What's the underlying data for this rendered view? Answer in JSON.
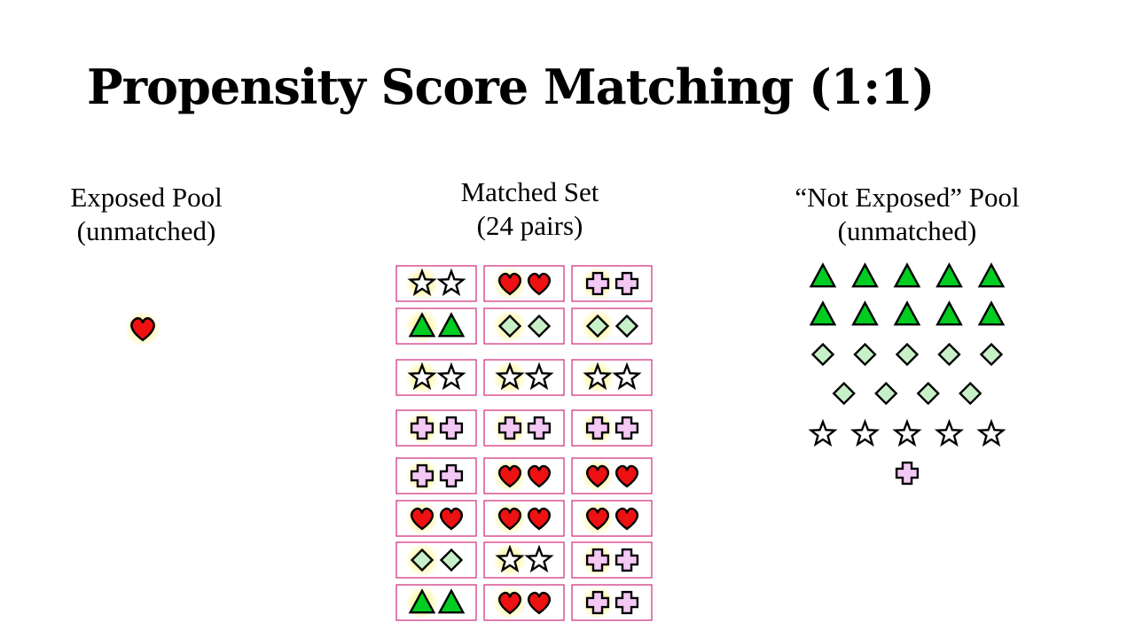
{
  "title": "Propensity Score Matching (1:1)",
  "exposed_pool": {
    "label_line1": "Exposed Pool",
    "label_line2": "(unmatched)",
    "items": [
      "heart"
    ]
  },
  "matched_set": {
    "label_line1": "Matched Set",
    "label_line2": "(24 pairs)",
    "rows": [
      [
        "star",
        "heart",
        "cross"
      ],
      [
        "triangle",
        "diamond",
        "diamond"
      ],
      [
        "star",
        "star",
        "star"
      ],
      [
        "cross",
        "cross",
        "cross"
      ],
      [
        "cross",
        "heart",
        "heart"
      ],
      [
        "heart",
        "heart",
        "heart"
      ],
      [
        "diamond",
        "star",
        "cross"
      ],
      [
        "triangle",
        "heart",
        "cross"
      ]
    ]
  },
  "not_exposed_pool": {
    "label_line1": "“Not Exposed” Pool",
    "label_line2": "(unmatched)",
    "rows": [
      [
        "triangle",
        "triangle",
        "triangle",
        "triangle",
        "triangle"
      ],
      [
        "triangle",
        "triangle",
        "triangle",
        "triangle",
        "triangle"
      ],
      [
        "diamond",
        "diamond",
        "diamond",
        "diamond",
        "diamond"
      ],
      [
        "diamond",
        "diamond",
        "diamond",
        "diamond"
      ],
      [
        "star",
        "star",
        "star",
        "star",
        "star"
      ],
      [
        "cross"
      ]
    ]
  },
  "colors": {
    "heart": "#ee1111",
    "triangle": "#00cc22",
    "diamond": "#c8f0c8",
    "cross": "#f4c8f4",
    "star": "#ffffff",
    "glow": "#fff7a0",
    "pair_border": "#d0287a"
  }
}
